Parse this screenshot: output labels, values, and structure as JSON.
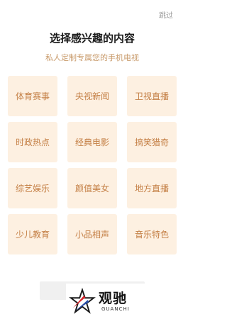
{
  "skip_label": "跳过",
  "title": "选择感兴趣的内容",
  "subtitle": "私人定制专属您的手机电视",
  "categories": [
    {
      "label": "体育赛事",
      "name": "sports"
    },
    {
      "label": "央视新闻",
      "name": "cctv-news"
    },
    {
      "label": "卫视直播",
      "name": "satellite-live"
    },
    {
      "label": "时政热点",
      "name": "politics-hot"
    },
    {
      "label": "经典电影",
      "name": "classic-movies"
    },
    {
      "label": "搞笑猎奇",
      "name": "funny-curious"
    },
    {
      "label": "综艺娱乐",
      "name": "variety-entertainment"
    },
    {
      "label": "颜值美女",
      "name": "beauty"
    },
    {
      "label": "地方直播",
      "name": "local-live"
    },
    {
      "label": "少儿教育",
      "name": "kids-education"
    },
    {
      "label": "小品相声",
      "name": "sketch-crosstalk"
    },
    {
      "label": "音乐特色",
      "name": "music-featured"
    }
  ],
  "watermark": {
    "text": "观驰",
    "sub": "GUANCHI"
  },
  "colors": {
    "tile_bg": "#fdf0e1",
    "tile_text": "#c47f45",
    "subtitle": "#c89a6a"
  }
}
